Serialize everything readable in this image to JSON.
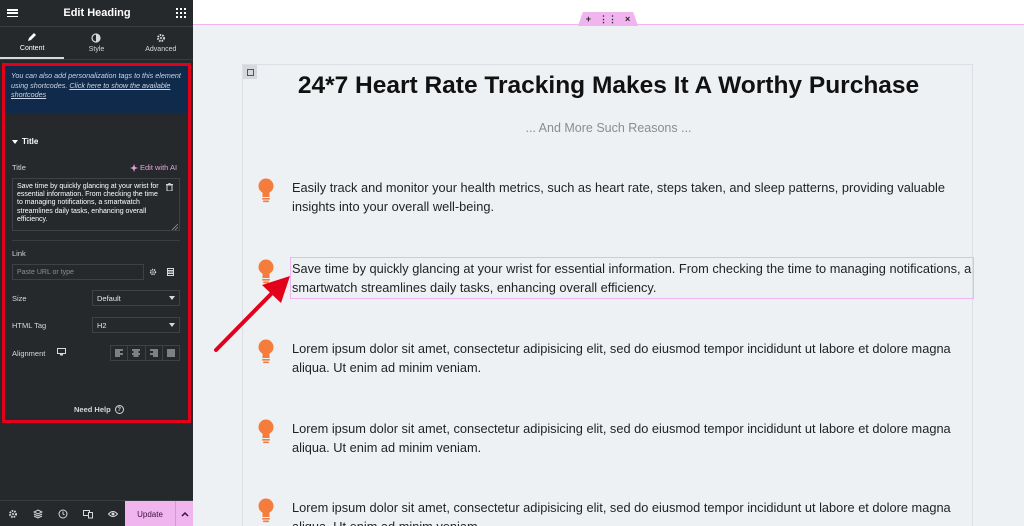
{
  "panel": {
    "title": "Edit Heading",
    "tabs": [
      {
        "label": "Content",
        "icon": "pencil-icon"
      },
      {
        "label": "Style",
        "icon": "half-circle-icon"
      },
      {
        "label": "Advanced",
        "icon": "gear-icon"
      }
    ],
    "notice": {
      "text": "You can also add personalization tags to this element using shortcodes. ",
      "link": "Click here to show the available shortcodes"
    },
    "section_title": "Title",
    "title_label": "Title",
    "ai_button": "Edit with AI",
    "title_value": "Save time by quickly glancing at your wrist for essential information. From checking the time to managing notifications, a smartwatch streamlines daily tasks, enhancing overall efficiency.",
    "link_label": "Link",
    "link_placeholder": "Paste URL or type",
    "size_label": "Size",
    "size_value": "Default",
    "html_tag_label": "HTML Tag",
    "html_tag_value": "H2",
    "alignment_label": "Alignment",
    "need_help": "Need Help",
    "update_label": "Update"
  },
  "canvas": {
    "heading": "24*7 Heart Rate Tracking Makes It A Worthy Purchase",
    "subheading": "... And More Such Reasons ...",
    "items": [
      {
        "text": "Easily track and monitor your health metrics, such as heart rate, steps taken, and sleep patterns, providing valuable insights into your overall well-being."
      },
      {
        "text": "Save time by quickly glancing at your wrist for essential information. From checking the time to managing notifications, a smartwatch streamlines daily tasks, enhancing overall efficiency."
      },
      {
        "text": "Lorem ipsum dolor sit amet, consectetur adipisicing elit, sed do eiusmod tempor incididunt ut labore et dolore magna aliqua. Ut enim ad minim veniam."
      },
      {
        "text": "Lorem ipsum dolor sit amet, consectetur adipisicing elit, sed do eiusmod tempor incididunt ut labore et dolore magna aliqua. Ut enim ad minim veniam."
      },
      {
        "text": "Lorem ipsum dolor sit amet, consectetur adipisicing elit, sed do eiusmod tempor incididunt ut labore et dolore magna aliqua. Ut enim ad minim veniam."
      }
    ]
  },
  "colors": {
    "panel_bg": "#26292c",
    "accent_pink": "#f0b4ef",
    "highlight_red": "#e3001b",
    "bulb_orange": "#f47c3c",
    "notice_bg": "#0f2a4a"
  }
}
